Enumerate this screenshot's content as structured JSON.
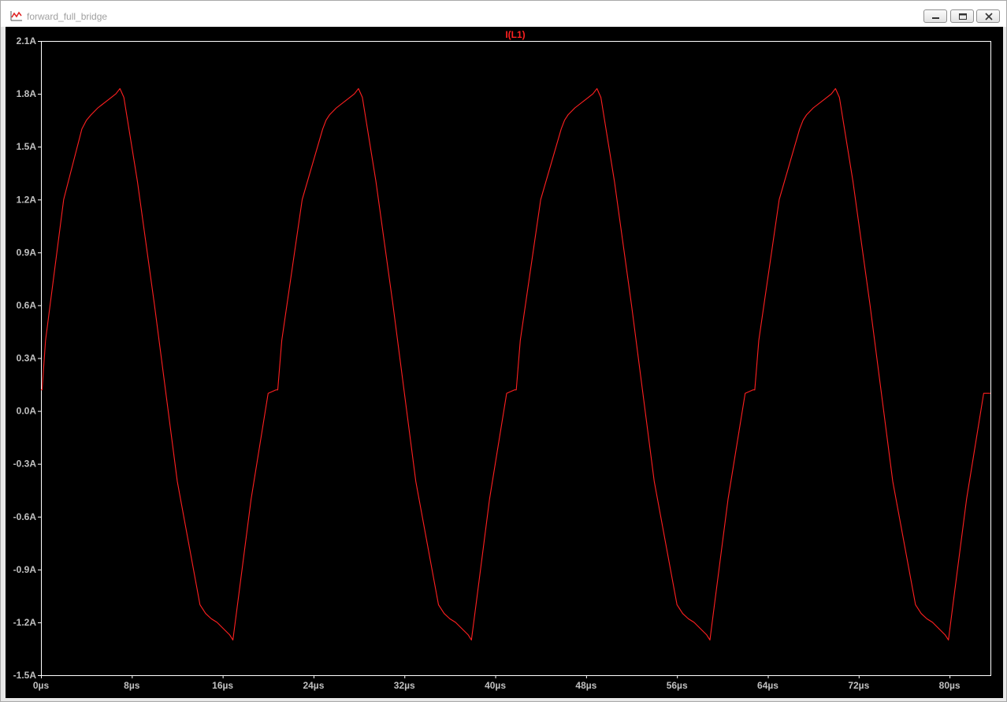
{
  "window": {
    "title": "forward_full_bridge",
    "icon": "waveform-icon",
    "controls": [
      "minimize-icon",
      "maximize-icon",
      "close-icon"
    ]
  },
  "chart_data": {
    "type": "line",
    "title": "I(L1)",
    "xlabel": "",
    "ylabel": "",
    "x_unit": "µs",
    "y_unit": "A",
    "xlim": [
      0,
      83.6
    ],
    "ylim": [
      -1.5,
      2.1
    ],
    "x_ticks": [
      0,
      8,
      16,
      24,
      32,
      40,
      48,
      56,
      64,
      72,
      80
    ],
    "y_ticks": [
      2.1,
      1.8,
      1.5,
      1.2,
      0.9,
      0.6,
      0.3,
      0.0,
      -0.3,
      -0.6,
      -0.9,
      -1.2,
      -1.5
    ],
    "x_tick_labels": [
      "0µs",
      "8µs",
      "16µs",
      "24µs",
      "32µs",
      "40µs",
      "48µs",
      "56µs",
      "64µs",
      "72µs",
      "80µs"
    ],
    "y_tick_labels": [
      "2.1A",
      "1.8A",
      "1.5A",
      "1.2A",
      "0.9A",
      "0.6A",
      "0.3A",
      "0.0A",
      "-0.3A",
      "-0.6A",
      "-0.9A",
      "-1.2A",
      "-1.5A"
    ],
    "grid": false,
    "colors": {
      "background": "#000000",
      "frame": "#ffffff",
      "trace": "#ff2020",
      "tick_text": "#c0c0c0"
    },
    "series": [
      {
        "color": "#ff2020",
        "x": [
          0.0,
          0.1,
          0.4,
          2.0,
          3.6,
          4.0,
          4.4,
          5.0,
          6.0,
          6.6,
          6.95,
          7.3,
          8.5,
          10.0,
          12.0,
          14.0,
          14.5,
          15.0,
          15.5,
          16.6,
          16.9,
          17.3,
          18.5,
          20.0,
          20.7,
          20.85,
          21.2,
          23.0,
          24.8,
          25.1,
          25.4,
          26.0,
          27.0,
          27.6,
          27.95,
          28.3,
          29.5,
          31.0,
          33.0,
          35.0,
          35.5,
          36.0,
          36.5,
          37.6,
          37.9,
          38.3,
          39.5,
          41.0,
          41.7,
          41.85,
          42.2,
          44.0,
          45.8,
          46.1,
          46.4,
          47.0,
          48.0,
          48.6,
          48.95,
          49.3,
          50.5,
          52.0,
          54.0,
          56.0,
          56.5,
          57.0,
          57.5,
          58.6,
          58.9,
          59.3,
          60.5,
          62.0,
          62.7,
          62.85,
          63.2,
          65.0,
          66.8,
          67.1,
          67.4,
          68.0,
          69.0,
          69.6,
          69.95,
          70.3,
          71.5,
          73.0,
          75.0,
          77.0,
          77.5,
          78.0,
          78.5,
          79.6,
          79.9,
          80.3,
          81.5,
          83.0,
          83.6
        ],
        "y": [
          0.12,
          0.12,
          0.4,
          1.2,
          1.6,
          1.65,
          1.68,
          1.72,
          1.77,
          1.8,
          1.83,
          1.78,
          1.3,
          0.6,
          -0.4,
          -1.1,
          -1.15,
          -1.18,
          -1.2,
          -1.27,
          -1.3,
          -1.1,
          -0.5,
          0.1,
          0.12,
          0.12,
          0.4,
          1.2,
          1.6,
          1.65,
          1.68,
          1.72,
          1.77,
          1.8,
          1.83,
          1.78,
          1.3,
          0.6,
          -0.4,
          -1.1,
          -1.15,
          -1.18,
          -1.2,
          -1.27,
          -1.3,
          -1.1,
          -0.5,
          0.1,
          0.12,
          0.12,
          0.4,
          1.2,
          1.6,
          1.65,
          1.68,
          1.72,
          1.77,
          1.8,
          1.83,
          1.78,
          1.3,
          0.6,
          -0.4,
          -1.1,
          -1.15,
          -1.18,
          -1.2,
          -1.27,
          -1.3,
          -1.1,
          -0.5,
          0.1,
          0.12,
          0.12,
          0.4,
          1.2,
          1.6,
          1.65,
          1.68,
          1.72,
          1.77,
          1.8,
          1.83,
          1.78,
          1.3,
          0.6,
          -0.4,
          -1.1,
          -1.15,
          -1.18,
          -1.2,
          -1.27,
          -1.3,
          -1.1,
          -0.5,
          0.1,
          0.1
        ]
      }
    ]
  }
}
